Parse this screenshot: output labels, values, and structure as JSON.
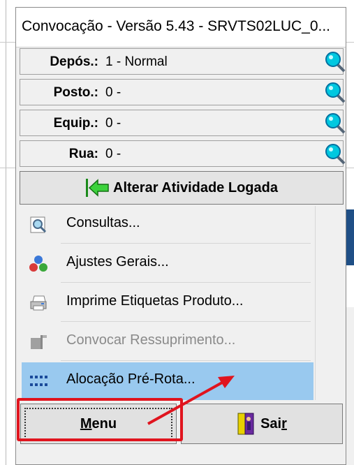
{
  "window": {
    "title": "Convocação - Versão 5.43 - SRVTS02LUC_0..."
  },
  "fields": [
    {
      "label": "Depós.:",
      "value": "1 - Normal"
    },
    {
      "label": "Posto.:",
      "value": "0 -"
    },
    {
      "label": "Equip.:",
      "value": "0 -"
    },
    {
      "label": "Rua:",
      "value": "0 -"
    }
  ],
  "alterar_button": {
    "label": "Alterar Atividade Logada"
  },
  "menu_items": [
    {
      "label": "Consultas...",
      "icon": "magnifier-document-icon",
      "enabled": true
    },
    {
      "label": "Ajustes Gerais...",
      "icon": "colored-blocks-icon",
      "enabled": true
    },
    {
      "label": "Imprime Etiquetas Produto...",
      "icon": "printer-icon",
      "enabled": true
    },
    {
      "label": "Convocar Ressuprimento...",
      "icon": "forklift-icon",
      "enabled": false
    },
    {
      "label": "Alocação Pré-Rota...",
      "icon": "grid-dots-icon",
      "enabled": true,
      "selected": true
    }
  ],
  "bottom": {
    "menu_first": "M",
    "menu_rest": "enu",
    "sair_start": "Sai",
    "sair_ul": "r"
  },
  "colors": {
    "selection": "#99c9ef",
    "highlight": "#e0141e",
    "window_bg": "#f0f0f0"
  }
}
